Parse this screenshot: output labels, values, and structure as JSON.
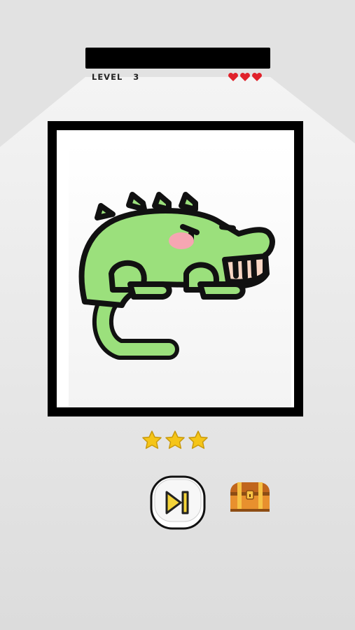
{
  "hud": {
    "level_label": "LEVEL",
    "level_number": "3",
    "lives": 3
  },
  "puzzle": {
    "image_icon": "crocodile-icon"
  },
  "result": {
    "stars_earned": 3,
    "stars_total": 3
  },
  "actions": {
    "skip_icon": "skip-next-icon",
    "chest_icon": "treasure-chest-icon"
  },
  "colors": {
    "background": "#e4e4e4",
    "frame": "#000000",
    "croc_green": "#9be07c",
    "heart_red": "#e0212a",
    "star_gold": "#f5c518",
    "skip_yellow": "#f4d43a",
    "chest_orange": "#e8902e"
  }
}
